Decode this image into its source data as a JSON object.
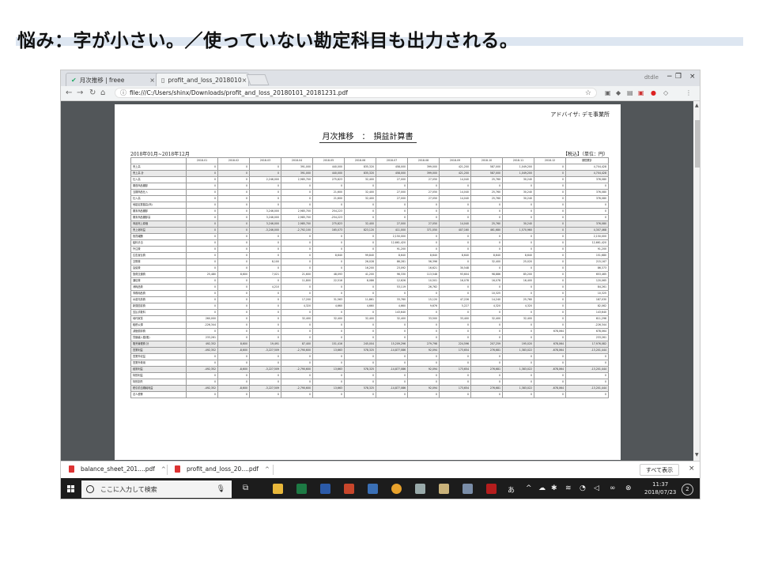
{
  "slide": {
    "title": "悩み：字が小さい。／使っていない勘定科目も出力される。"
  },
  "browser": {
    "tabs": [
      {
        "label": "月次推移 | freee",
        "close": "×"
      },
      {
        "label": "profit_and_loss_2018010",
        "close": "×"
      }
    ],
    "account": "dtdle",
    "window": {
      "minimize": "−",
      "maximize": "❐",
      "close": "×"
    },
    "nav": {
      "back": "←",
      "forward": "→",
      "reload": "↻",
      "home": "⌂"
    },
    "address": "file:///C:/Users/shinx/Downloads/profit_and_loss_20180101_20181231.pdf",
    "star": "☆"
  },
  "report": {
    "advisor": "アドバイザ: デモ事業所",
    "title": "月次推移　：　損益計算書",
    "period": "2018年01月~2018年12月",
    "tax": "【税込】（単位：円）",
    "columns": [
      "",
      "2018-01",
      "2018-02",
      "2018-03",
      "2018-04",
      "2018-05",
      "2018-06",
      "2018-07",
      "2018-08",
      "2018-09",
      "2018-10",
      "2018-11",
      "2018-12",
      "期間累計"
    ],
    "rows": [
      {
        "shade": false,
        "cells": [
          "売上高",
          "0",
          "0",
          "0",
          "391,000",
          "440,000",
          "835,320",
          "458,000",
          "399,000",
          "421,200",
          "587,000",
          "1,049,200",
          "0",
          "4,704,428"
        ]
      },
      {
        "shade": true,
        "cells": [
          "売上高 計",
          "0",
          "0",
          "0",
          "391,000",
          "440,000",
          "835,320",
          "458,000",
          "399,000",
          "421,200",
          "587,000",
          "1,049,200",
          "0",
          "4,704,428"
        ]
      },
      {
        "shade": false,
        "cells": [
          "仕入高",
          "0",
          "0",
          "2,246,000",
          "2,985,700",
          "275,823",
          "32,400",
          "27,000",
          "27,050",
          "14,040",
          "25,760",
          "30,240",
          "0",
          "376,080"
        ]
      },
      {
        "shade": false,
        "cells": [
          "期首商品棚卸",
          "0",
          "0",
          "0",
          "0",
          "0",
          "0",
          "0",
          "0",
          "0",
          "0",
          "0",
          "0",
          "0"
        ]
      },
      {
        "shade": false,
        "cells": [
          "当期商品仕入",
          "0",
          "0",
          "0",
          "0",
          "21,600",
          "32,400",
          "27,000",
          "27,050",
          "14,040",
          "25,760",
          "30,240",
          "0",
          "376,080"
        ]
      },
      {
        "shade": false,
        "cells": [
          "仕入高",
          "0",
          "0",
          "0",
          "0",
          "21,600",
          "32,400",
          "27,000",
          "27,050",
          "14,040",
          "25,760",
          "30,240",
          "0",
          "376,080"
        ]
      },
      {
        "shade": false,
        "cells": [
          "他勘定振替高(商)",
          "0",
          "0",
          "0",
          "0",
          "0",
          "0",
          "0",
          "0",
          "0",
          "0",
          "0",
          "0",
          "0"
        ]
      },
      {
        "shade": false,
        "cells": [
          "期末商品棚卸",
          "0",
          "0",
          "3,246,000",
          "2,985,700",
          "254,223",
          "0",
          "0",
          "0",
          "0",
          "0",
          "0",
          "0",
          "0"
        ]
      },
      {
        "shade": false,
        "cells": [
          "期末商品棚卸高",
          "0",
          "0",
          "3,246,000",
          "2,985,700",
          "-254,223",
          "0",
          "0",
          "0",
          "0",
          "0",
          "0",
          "0",
          "0"
        ]
      },
      {
        "shade": true,
        "cells": [
          "商品売上原価",
          "0",
          "0",
          "3,246,000",
          "2,985,700",
          "275,823",
          "32,400",
          "27,000",
          "27,050",
          "14,040",
          "25,760",
          "30,240",
          "0",
          "376,080"
        ]
      },
      {
        "shade": true,
        "cells": [
          "売上総利益",
          "0",
          "0",
          "-3,246,000",
          "-2,792,100",
          "165,073",
          "823,120",
          "411,000",
          "371,050",
          "407,160",
          "461,680",
          "1,570,960",
          "0",
          "4,307,468"
        ]
      },
      {
        "shade": false,
        "cells": [
          "役員報酬",
          "0",
          "0",
          "0",
          "0",
          "0",
          "0",
          "2,150,000",
          "0",
          "0",
          "0",
          "0",
          "0",
          "2,150,000"
        ]
      },
      {
        "shade": false,
        "cells": [
          "給料手当",
          "0",
          "0",
          "0",
          "0",
          "0",
          "0",
          "12,661,420",
          "0",
          "0",
          "0",
          "0",
          "0",
          "12,661,420"
        ]
      },
      {
        "shade": false,
        "cells": [
          "外注費",
          "0",
          "0",
          "0",
          "0",
          "0",
          "0",
          "91,200",
          "0",
          "0",
          "0",
          "0",
          "0",
          "91,200"
        ]
      },
      {
        "shade": false,
        "cells": [
          "広告宣伝費",
          "0",
          "0",
          "0",
          "0",
          "8,640",
          "99,840",
          "8,640",
          "8,640",
          "8,640",
          "8,640",
          "8,640",
          "0",
          "151,680"
        ]
      },
      {
        "shade": false,
        "cells": [
          "交際費",
          "0",
          "0",
          "8,100",
          "0",
          "0",
          "26,028",
          "86,281",
          "56,396",
          "0",
          "32,400",
          "25,020",
          "0",
          "215,167"
        ]
      },
      {
        "shade": false,
        "cells": [
          "会議費",
          "0",
          "0",
          "0",
          "0",
          "0",
          "16,200",
          "23,092",
          "16,621",
          "30,548",
          "0",
          "0",
          "0",
          "86,373"
        ]
      },
      {
        "shade": false,
        "cells": [
          "旅費交通費",
          "25,480",
          "8,600",
          "7,021",
          "21,600",
          "48,093",
          "41,200",
          "96,330",
          "113,548",
          "93,604",
          "98,886",
          "85,200",
          "0",
          "653,465"
        ]
      },
      {
        "shade": false,
        "cells": [
          "通信費",
          "0",
          "0",
          "0",
          "11,800",
          "22,516",
          "8,086",
          "12,626",
          "10,501",
          "16,078",
          "16,078",
          "16,400",
          "0",
          "120,065"
        ]
      },
      {
        "shade": false,
        "cells": [
          "消耗品費",
          "0",
          "0",
          "4,210",
          "0",
          "0",
          "0",
          "53,119",
          "26,762",
          "0",
          "0",
          "0",
          "0",
          "84,261"
        ]
      },
      {
        "shade": false,
        "cells": [
          "事務用品費",
          "0",
          "0",
          "0",
          "0",
          "0",
          "0",
          "0",
          "0",
          "0",
          "10,325",
          "0",
          "0",
          "10,325"
        ]
      },
      {
        "shade": false,
        "cells": [
          "水道光熱費",
          "0",
          "0",
          "0",
          "17,200",
          "31,563",
          "11,861",
          "33,760",
          "15,120",
          "47,226",
          "14,240",
          "25,760",
          "0",
          "187,030"
        ]
      },
      {
        "shade": false,
        "cells": [
          "新聞図書費",
          "0",
          "0",
          "0",
          "4,320",
          "4,660",
          "4,660",
          "4,660",
          "9,676",
          "5,227",
          "4,320",
          "4,320",
          "0",
          "82,062"
        ]
      },
      {
        "shade": false,
        "cells": [
          "支払手数料",
          "0",
          "0",
          "0",
          "0",
          "0",
          "0",
          "143,640",
          "0",
          "0",
          "0",
          "0",
          "0",
          "143,640"
        ]
      },
      {
        "shade": false,
        "cells": [
          "地代家賃",
          "260,000",
          "0",
          "0",
          "32,400",
          "32,400",
          "32,400",
          "32,400",
          "33,500",
          "33,400",
          "32,400",
          "32,400",
          "0",
          "611,296"
        ]
      },
      {
        "shade": false,
        "cells": [
          "租税公課",
          "-226,344",
          "0",
          "0",
          "0",
          "0",
          "0",
          "0",
          "0",
          "0",
          "0",
          "0",
          "0",
          "-226,344"
        ]
      },
      {
        "shade": false,
        "cells": [
          "減価償却費",
          "0",
          "0",
          "0",
          "0",
          "0",
          "0",
          "0",
          "0",
          "0",
          "0",
          "0",
          "678,064",
          "678,064"
        ]
      },
      {
        "shade": false,
        "cells": [
          "貸倒繰入額(販)",
          "233,261",
          "0",
          "0",
          "0",
          "0",
          "0",
          "0",
          "0",
          "0",
          "0",
          "0",
          "0",
          "233,261"
        ]
      },
      {
        "shade": true,
        "cells": [
          "販売管理費 計",
          "492,352",
          "8,600",
          "19,491",
          "87,400",
          "151,416",
          "245,004",
          "15,209,296",
          "279,798",
          "224,596",
          "207,259",
          "195,020",
          "678,064",
          "17,976,082"
        ]
      },
      {
        "shade": true,
        "cells": [
          "営業利益",
          "-492,352",
          "-8,600",
          "-3,227,509",
          "-2,790,600",
          "13,663",
          "578,325",
          "-14,877,086",
          "92,094",
          "173,654",
          "276,681",
          "1,383,022",
          "-678,064",
          "-13,201,444"
        ]
      },
      {
        "shade": false,
        "cells": [
          "営業外収益",
          "0",
          "0",
          "0",
          "0",
          "0",
          "0",
          "0",
          "0",
          "0",
          "0",
          "0",
          "0",
          "0"
        ]
      },
      {
        "shade": false,
        "cells": [
          "営業外費用",
          "0",
          "0",
          "0",
          "0",
          "0",
          "0",
          "0",
          "0",
          "0",
          "0",
          "0",
          "0",
          "0"
        ]
      },
      {
        "shade": true,
        "cells": [
          "経常利益",
          "-492,352",
          "-8,600",
          "-3,227,509",
          "-2,790,600",
          "13,663",
          "578,325",
          "-14,877,086",
          "92,094",
          "173,654",
          "276,681",
          "1,383,022",
          "-678,064",
          "-13,201,444"
        ]
      },
      {
        "shade": false,
        "cells": [
          "特別利益",
          "0",
          "0",
          "0",
          "0",
          "0",
          "0",
          "0",
          "0",
          "0",
          "0",
          "0",
          "0",
          "0"
        ]
      },
      {
        "shade": false,
        "cells": [
          "特別損失",
          "0",
          "0",
          "0",
          "0",
          "0",
          "0",
          "0",
          "0",
          "0",
          "0",
          "0",
          "0",
          "0"
        ]
      },
      {
        "shade": true,
        "cells": [
          "税引前当期純利益",
          "-492,352",
          "-8,600",
          "-3,227,509",
          "-2,790,600",
          "13,663",
          "578,325",
          "-14,877,086",
          "92,094",
          "173,654",
          "276,681",
          "1,383,022",
          "-678,064",
          "-13,201,444"
        ]
      },
      {
        "shade": false,
        "cells": [
          "法人税等",
          "0",
          "0",
          "0",
          "0",
          "0",
          "0",
          "0",
          "0",
          "0",
          "0",
          "0",
          "0",
          "0"
        ]
      }
    ]
  },
  "downloads": {
    "items": [
      {
        "label": "balance_sheet_201....pdf",
        "chevron": "^"
      },
      {
        "label": "profit_and_loss_20....pdf",
        "chevron": "^"
      }
    ],
    "show_all": "すべて表示",
    "close": "×"
  },
  "taskbar": {
    "search_placeholder": "ここに入力して検索",
    "time": "11:37",
    "date": "2018/07/23",
    "notifications": "2",
    "ime": "あ"
  },
  "colors": {
    "accent": "#dde6f1",
    "pdf_bg": "#525659",
    "taskbar": "#1c1c1c"
  }
}
